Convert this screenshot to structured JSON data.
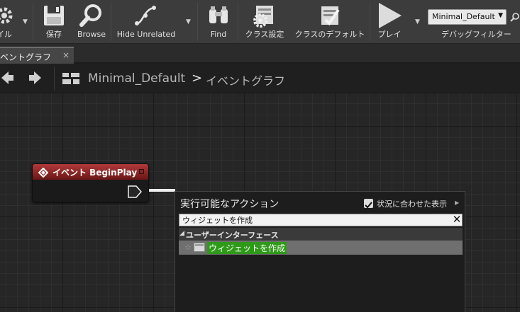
{
  "toolbar": {
    "partial_label": "イル",
    "save_label": "保存",
    "browse_label": "Browse",
    "hide_unrelated_label": "Hide Unrelated",
    "find_label": "Find",
    "class_settings_label": "クラス設定",
    "class_defaults_label": "クラスのデフォルト",
    "play_label": "プレイ",
    "debug_object": "Minimal_Default",
    "debug_filter_label": "デバッグフィルター"
  },
  "tab": {
    "label": "ベントグラフ",
    "close": "×"
  },
  "breadcrumb": {
    "level": "Minimal_Default",
    "separator": ">",
    "graph": "イベントグラフ"
  },
  "node": {
    "title": "イベント BeginPlay"
  },
  "action_menu": {
    "title": "実行可能なアクション",
    "context_sensitive_label": "状況に合わせた表示",
    "context_sensitive_checked": true,
    "search_value": "ウィジェットを作成",
    "category": "ユーザーインターフェース",
    "items": [
      {
        "label": "ウィジェットを作成"
      }
    ]
  },
  "colors": {
    "event_header": "#b13a3a",
    "highlight": "#2f9a1a"
  }
}
